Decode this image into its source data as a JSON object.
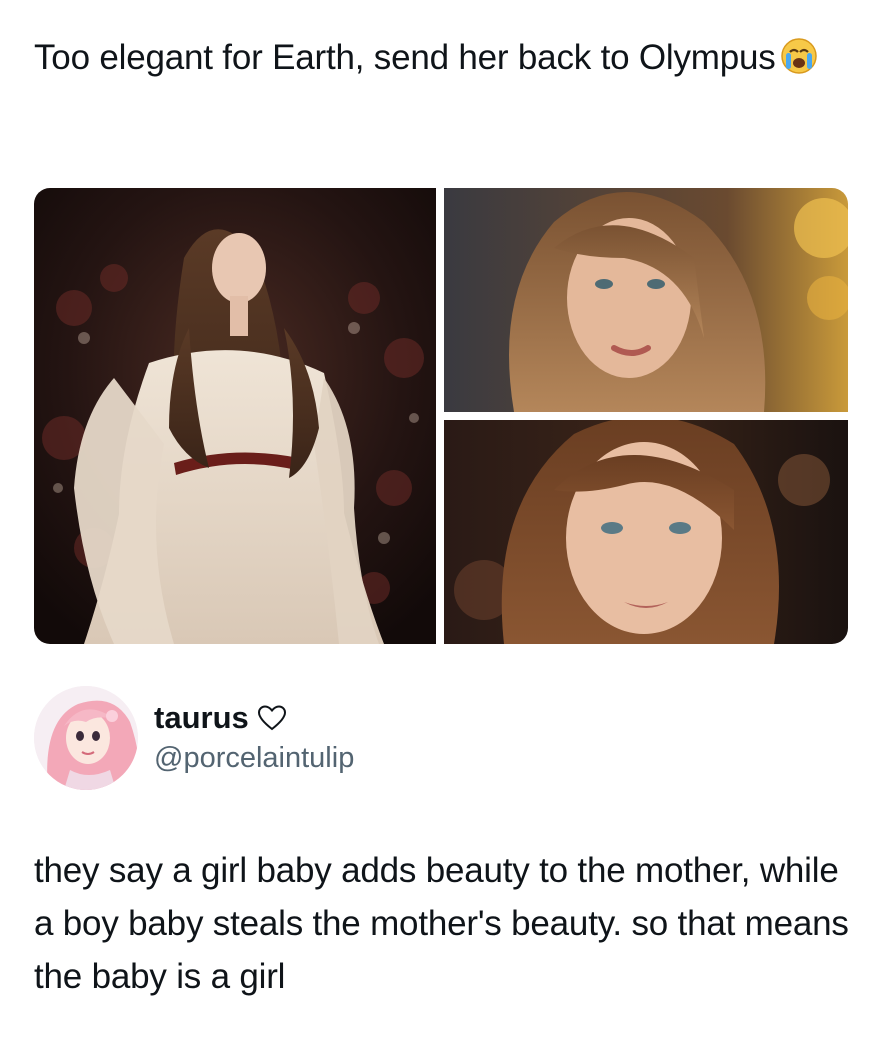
{
  "post": {
    "caption": "Too elegant for Earth, send her back to Olympus",
    "caption_emoji": "loudly-crying-face-emoji"
  },
  "images": [
    {
      "name": "red-carpet-full-length-photo"
    },
    {
      "name": "close-up-portrait-photo-1"
    },
    {
      "name": "close-up-portrait-photo-2"
    }
  ],
  "quoted_tweet": {
    "display_name": "taurus",
    "name_icon": "heart-outline-icon",
    "handle": "@porcelaintulip",
    "text": "they say a girl baby adds beauty to the mother, while a boy baby steals the mother's beauty. so that means the baby is a girl"
  }
}
